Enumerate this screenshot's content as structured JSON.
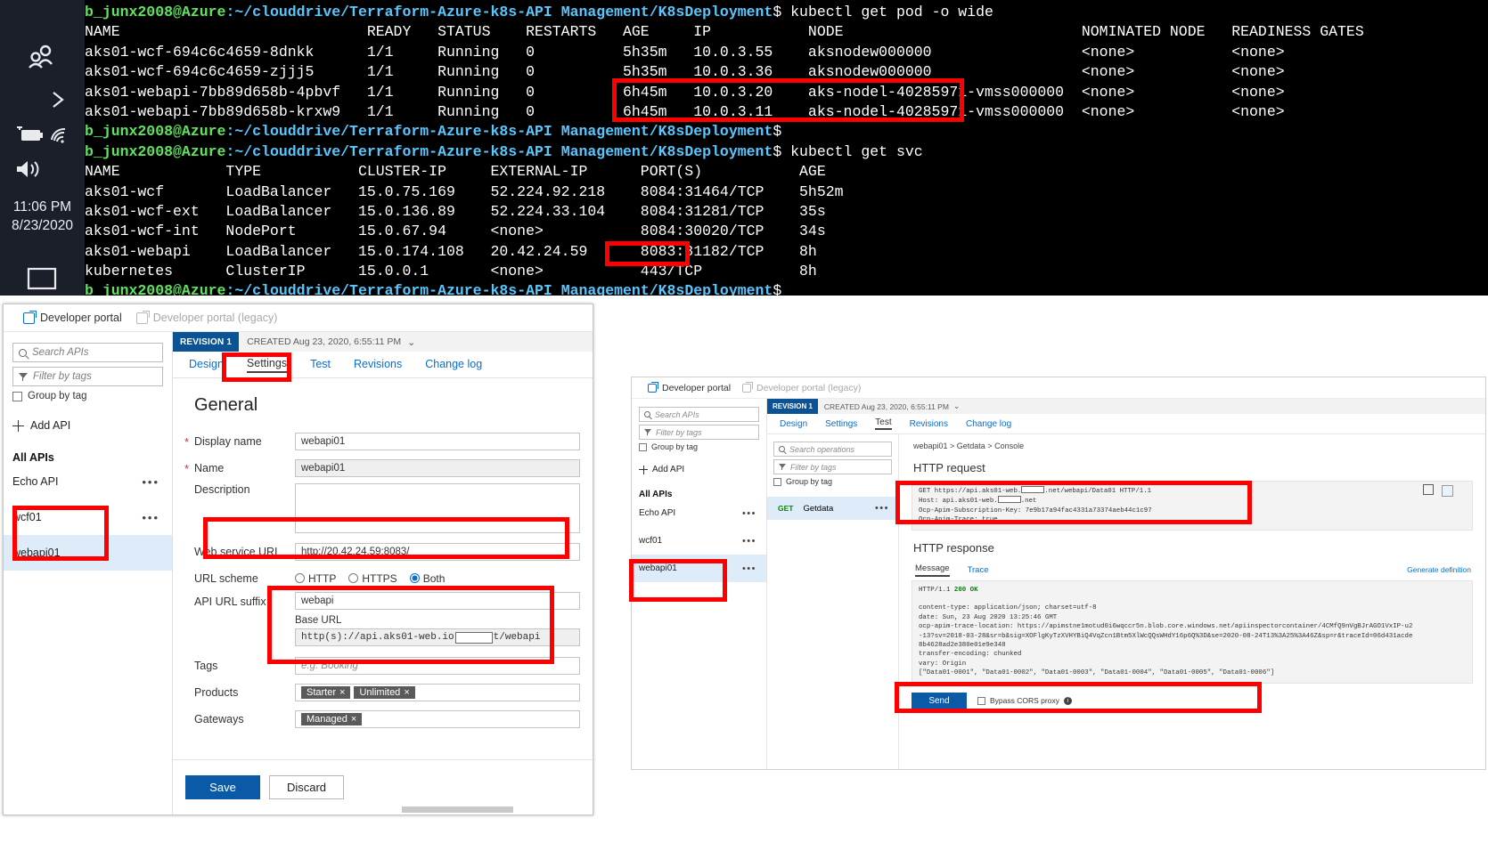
{
  "tray": {
    "time": "11:06 PM",
    "date": "8/23/2020",
    "icons": [
      "people-icon",
      "chevron-right-icon",
      "battery-charging-icon",
      "wifi-icon",
      "volume-icon",
      "window-icon"
    ]
  },
  "terminal": {
    "lines": [
      {
        "type": "prompt",
        "user": "b_junx2008@Azure",
        "path": ":~/clouddrive/Terraform-Azure-k8s-API Management/K8sDeployment",
        "cmd": "$ kubectl get pod -o wide"
      },
      {
        "type": "text",
        "text": "NAME                            READY   STATUS    RESTARTS   AGE     IP           NODE                           NOMINATED NODE   READINESS GATES"
      },
      {
        "type": "text",
        "text": "aks01-wcf-694c6c4659-8dnkk      1/1     Running   0          5h35m   10.0.3.55    aksnodew000000                 <none>           <none>"
      },
      {
        "type": "text",
        "text": "aks01-wcf-694c6c4659-zjjj5      1/1     Running   0          5h35m   10.0.3.36    aksnodew000000                 <none>           <none>"
      },
      {
        "type": "text",
        "text": "aks01-webapi-7bb89d658b-4pbvf   1/1     Running   0          6h45m   10.0.3.20    aks-nodel-40285971-vmss000000  <none>           <none>"
      },
      {
        "type": "text",
        "text": "aks01-webapi-7bb89d658b-krxw9   1/1     Running   0          6h45m   10.0.3.11    aks-nodel-40285971-vmss000000  <none>           <none>"
      },
      {
        "type": "prompt",
        "user": "b_junx2008@Azure",
        "path": ":~/clouddrive/Terraform-Azure-k8s-API Management/K8sDeployment",
        "cmd": "$"
      },
      {
        "type": "prompt",
        "user": "b_junx2008@Azure",
        "path": ":~/clouddrive/Terraform-Azure-k8s-API Management/K8sDeployment",
        "cmd": "$ kubectl get svc"
      },
      {
        "type": "text",
        "text": "NAME            TYPE           CLUSTER-IP     EXTERNAL-IP      PORT(S)           AGE"
      },
      {
        "type": "text",
        "text": "aks01-wcf       LoadBalancer   15.0.75.169    52.224.92.218    8084:31464/TCP    5h52m"
      },
      {
        "type": "text",
        "text": "aks01-wcf-ext   LoadBalancer   15.0.136.89    52.224.33.104    8084:31281/TCP    35s"
      },
      {
        "type": "text",
        "text": "aks01-wcf-int   NodePort       15.0.67.94     <none>           8084:30020/TCP    34s"
      },
      {
        "type": "text",
        "text": "aks01-webapi    LoadBalancer   15.0.174.108   20.42.24.59      8083:31182/TCP    8h"
      },
      {
        "type": "text",
        "text": "kubernetes      ClusterIP      15.0.0.1       <none>           443/TCP           8h"
      },
      {
        "type": "prompt",
        "user": "b_junx2008@Azure",
        "path": ":~/clouddrive/Terraform-Azure-k8s-API Management/K8sDeployment",
        "cmd": "$"
      }
    ]
  },
  "panelA": {
    "devportal": "Developer portal",
    "devportal_legacy": "Developer portal (legacy)",
    "search_placeholder": "Search APIs",
    "filter_placeholder": "Filter by tags",
    "group_by_tag": "Group by tag",
    "add_api": "Add API",
    "all_apis": "All APIs",
    "api_items": [
      {
        "label": "Echo API"
      },
      {
        "label": "wcf01"
      },
      {
        "label": "webapi01"
      }
    ],
    "revision_badge": "REVISION 1",
    "revision_meta": "CREATED Aug 23, 2020, 6:55:11 PM",
    "tabs": [
      "Design",
      "Settings",
      "Test",
      "Revisions",
      "Change log"
    ],
    "active_tab": "Settings",
    "section_title": "General",
    "fields": {
      "display_name_label": "Display name",
      "display_name_value": "webapi01",
      "name_label": "Name",
      "name_value": "webapi01",
      "description_label": "Description",
      "description_value": "",
      "web_service_url_label": "Web service URL",
      "web_service_url_value": "http://20.42.24.59:8083/",
      "url_scheme_label": "URL scheme",
      "url_scheme_options": [
        "HTTP",
        "HTTPS",
        "Both"
      ],
      "url_scheme_selected": "Both",
      "api_url_suffix_label": "API URL suffix",
      "api_url_suffix_value": "webapi",
      "base_url_label": "Base URL",
      "base_url_prefix": "http(s)://api.aks01-web.io",
      "base_url_suffix": "t/webapi",
      "tags_label": "Tags",
      "tags_placeholder": "e.g. Booking",
      "products_label": "Products",
      "products": [
        "Starter",
        "Unlimited"
      ],
      "gateways_label": "Gateways",
      "gateways": [
        "Managed"
      ]
    },
    "save_label": "Save",
    "discard_label": "Discard"
  },
  "panelB": {
    "devportal": "Developer portal",
    "devportal_legacy": "Developer portal (legacy)",
    "search_placeholder": "Search APIs",
    "filter_placeholder": "Filter by tags",
    "group_by_tag": "Group by tag",
    "add_api": "Add API",
    "all_apis": "All APIs",
    "api_items": [
      {
        "label": "Echo API"
      },
      {
        "label": "wcf01"
      },
      {
        "label": "webapi01"
      }
    ],
    "revision_badge": "REVISION 1",
    "revision_meta": "CREATED Aug 23, 2020, 6:55:11 PM",
    "tabs": [
      "Design",
      "Settings",
      "Test",
      "Revisions",
      "Change log"
    ],
    "active_tab": "Test",
    "op_search_placeholder": "Search operations",
    "op_filter_placeholder": "Filter by tags",
    "op_group_by_tag": "Group by tag",
    "operations": [
      {
        "verb": "GET",
        "name": "Getdata"
      }
    ],
    "breadcrumb": "webapi01  >  Getdata  >  Console",
    "http_request_title": "HTTP request",
    "request_line1_a": "GET https://api.aks01-web.",
    "request_line1_b": ".net/webapi/Data01 HTTP/1.1",
    "request_line2_a": "Host: api.aks01-web.",
    "request_line2_b": ".net",
    "request_line3": "Ocp-Apim-Subscription-Key: 7e9b17a94fac4331a73374aeb44c1c97",
    "request_line4": "Ocp-Apim-Trace: true",
    "http_response_title": "HTTP response",
    "generate_definition": "Generate definition",
    "response_tabs": [
      "Message",
      "Trace"
    ],
    "response_active_tab": "Message",
    "status_line_proto": "HTTP/1.1",
    "status_code": "200",
    "status_text": "OK",
    "response_headers": [
      "content-type: application/json; charset=utf-8",
      "date: Sun, 23 Aug 2020 13:25:46 GMT",
      "ocp-apim-trace-location: https://apimstne1motud0i6wqccr5n.blob.core.windows.net/apiinspectorcontainer/4CMfQ9nVgBJrAGO1VxIP-u2",
      "-13?sv=2018-03-28&sr=b&sig=XOFlgKyTzXVHYBiQ4VqZcn1Btm5XlWcQQsWHdY16p6Q%3D&se=2020-08-24T13%3A25%3A46Z&sp=r&traceId=06d431acde",
      "8b4628ad2e380e01e9e348",
      "transfer-encoding: chunked"
    ],
    "response_vary": "vary: Origin",
    "response_body": "[\"Data01-0001\", \"Data01-0002\", \"Data01-0003\", \"Data01-0004\", \"Data01-0005\", \"Data01-0006\"]",
    "send_label": "Send",
    "bypass_cors": "Bypass CORS proxy"
  },
  "annotations": {
    "highlight_color": "#ff0000"
  }
}
